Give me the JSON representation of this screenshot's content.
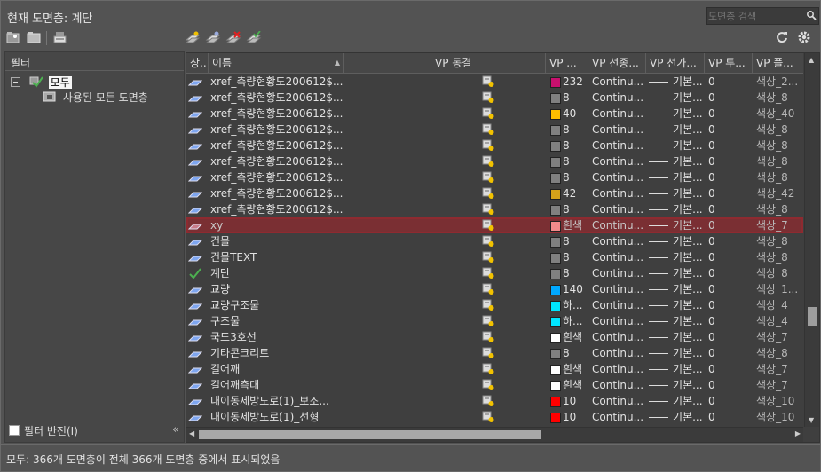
{
  "window": {
    "title": "현재 도면층: 계단"
  },
  "search": {
    "placeholder": "도면층 검색"
  },
  "filter_pane": {
    "header": "필터",
    "tree": [
      {
        "label": "모두"
      },
      {
        "label": "사용된 모든 도면층"
      }
    ],
    "invert_label": "필터 반전(I)"
  },
  "table": {
    "columns": [
      "상..",
      "이름",
      "VP 동결",
      "VP ...",
      "VP 선종...",
      "VP 선가...",
      "VP 투...",
      "VP 플..."
    ],
    "rows": [
      {
        "name": "xref_측량현황도200612$...",
        "color_label": "232",
        "color": "#c8106e",
        "linetype": "Continu...",
        "lineweight": "기본...",
        "transparency": "0",
        "plot_style": "색상_2...",
        "status": "layer",
        "selected": false
      },
      {
        "name": "xref_측량현황도200612$...",
        "color_label": "8",
        "color": "#808080",
        "linetype": "Continu...",
        "lineweight": "기본...",
        "transparency": "0",
        "plot_style": "색상_8",
        "status": "layer",
        "selected": false
      },
      {
        "name": "xref_측량현황도200612$...",
        "color_label": "40",
        "color": "#ffbf00",
        "linetype": "Continu...",
        "lineweight": "기본...",
        "transparency": "0",
        "plot_style": "색상_40",
        "status": "layer",
        "selected": false
      },
      {
        "name": "xref_측량현황도200612$...",
        "color_label": "8",
        "color": "#808080",
        "linetype": "Continu...",
        "lineweight": "기본...",
        "transparency": "0",
        "plot_style": "색상_8",
        "status": "layer",
        "selected": false
      },
      {
        "name": "xref_측량현황도200612$...",
        "color_label": "8",
        "color": "#808080",
        "linetype": "Continu...",
        "lineweight": "기본...",
        "transparency": "0",
        "plot_style": "색상_8",
        "status": "layer",
        "selected": false
      },
      {
        "name": "xref_측량현황도200612$...",
        "color_label": "8",
        "color": "#808080",
        "linetype": "Continu...",
        "lineweight": "기본...",
        "transparency": "0",
        "plot_style": "색상_8",
        "status": "layer",
        "selected": false
      },
      {
        "name": "xref_측량현황도200612$...",
        "color_label": "8",
        "color": "#808080",
        "linetype": "Continu...",
        "lineweight": "기본...",
        "transparency": "0",
        "plot_style": "색상_8",
        "status": "layer",
        "selected": false
      },
      {
        "name": "xref_측량현황도200612$...",
        "color_label": "42",
        "color": "#d6a21a",
        "linetype": "Continu...",
        "lineweight": "기본...",
        "transparency": "0",
        "plot_style": "색상_42",
        "status": "layer",
        "selected": false
      },
      {
        "name": "xref_측량현황도200612$...",
        "color_label": "8",
        "color": "#808080",
        "linetype": "Continu...",
        "lineweight": "기본...",
        "transparency": "0",
        "plot_style": "색상_8",
        "status": "layer",
        "selected": false
      },
      {
        "name": "xy",
        "color_label": "흰색",
        "color": "#f08a8a",
        "linetype": "Continu...",
        "lineweight": "기본...",
        "transparency": "0",
        "plot_style": "색상_7",
        "status": "layer",
        "selected": true
      },
      {
        "name": "건물",
        "color_label": "8",
        "color": "#808080",
        "linetype": "Continu...",
        "lineweight": "기본...",
        "transparency": "0",
        "plot_style": "색상_8",
        "status": "layer",
        "selected": false
      },
      {
        "name": "건물TEXT",
        "color_label": "8",
        "color": "#808080",
        "linetype": "Continu...",
        "lineweight": "기본...",
        "transparency": "0",
        "plot_style": "색상_8",
        "status": "layer",
        "selected": false
      },
      {
        "name": "계단",
        "color_label": "8",
        "color": "#808080",
        "linetype": "Continu...",
        "lineweight": "기본...",
        "transparency": "0",
        "plot_style": "색상_8",
        "status": "current",
        "selected": false
      },
      {
        "name": "교량",
        "color_label": "140",
        "color": "#00a8ff",
        "linetype": "Continu...",
        "lineweight": "기본...",
        "transparency": "0",
        "plot_style": "색상_1...",
        "status": "layer",
        "selected": false
      },
      {
        "name": "교량구조물",
        "color_label": "하...",
        "color": "#00e5ff",
        "linetype": "Continu...",
        "lineweight": "기본...",
        "transparency": "0",
        "plot_style": "색상_4",
        "status": "layer",
        "selected": false
      },
      {
        "name": "구조물",
        "color_label": "하...",
        "color": "#00e5ff",
        "linetype": "Continu...",
        "lineweight": "기본...",
        "transparency": "0",
        "plot_style": "색상_4",
        "status": "layer",
        "selected": false
      },
      {
        "name": "국도3호선",
        "color_label": "흰색",
        "color": "#ffffff",
        "linetype": "Continu...",
        "lineweight": "기본...",
        "transparency": "0",
        "plot_style": "색상_7",
        "status": "layer",
        "selected": false
      },
      {
        "name": "기타콘크리트",
        "color_label": "8",
        "color": "#808080",
        "linetype": "Continu...",
        "lineweight": "기본...",
        "transparency": "0",
        "plot_style": "색상_8",
        "status": "layer",
        "selected": false
      },
      {
        "name": "길어깨",
        "color_label": "흰색",
        "color": "#ffffff",
        "linetype": "Continu...",
        "lineweight": "기본...",
        "transparency": "0",
        "plot_style": "색상_7",
        "status": "layer",
        "selected": false
      },
      {
        "name": "길어깨측대",
        "color_label": "흰색",
        "color": "#ffffff",
        "linetype": "Continu...",
        "lineweight": "기본...",
        "transparency": "0",
        "plot_style": "색상_7",
        "status": "layer",
        "selected": false
      },
      {
        "name": "내이동제방도로(1)_보조...",
        "color_label": "10",
        "color": "#ff0000",
        "linetype": "Continu...",
        "lineweight": "기본...",
        "transparency": "0",
        "plot_style": "색상_10",
        "status": "layer",
        "selected": false
      },
      {
        "name": "내이동제방도로(1)_선형",
        "color_label": "10",
        "color": "#ff0000",
        "linetype": "Continu...",
        "lineweight": "기본...",
        "transparency": "0",
        "plot_style": "색상_10",
        "status": "layer",
        "selected": false
      }
    ]
  },
  "status_bar": {
    "text": "모두: 366개 도면층이 전체 366개 도면층 중에서 표시되었음"
  }
}
